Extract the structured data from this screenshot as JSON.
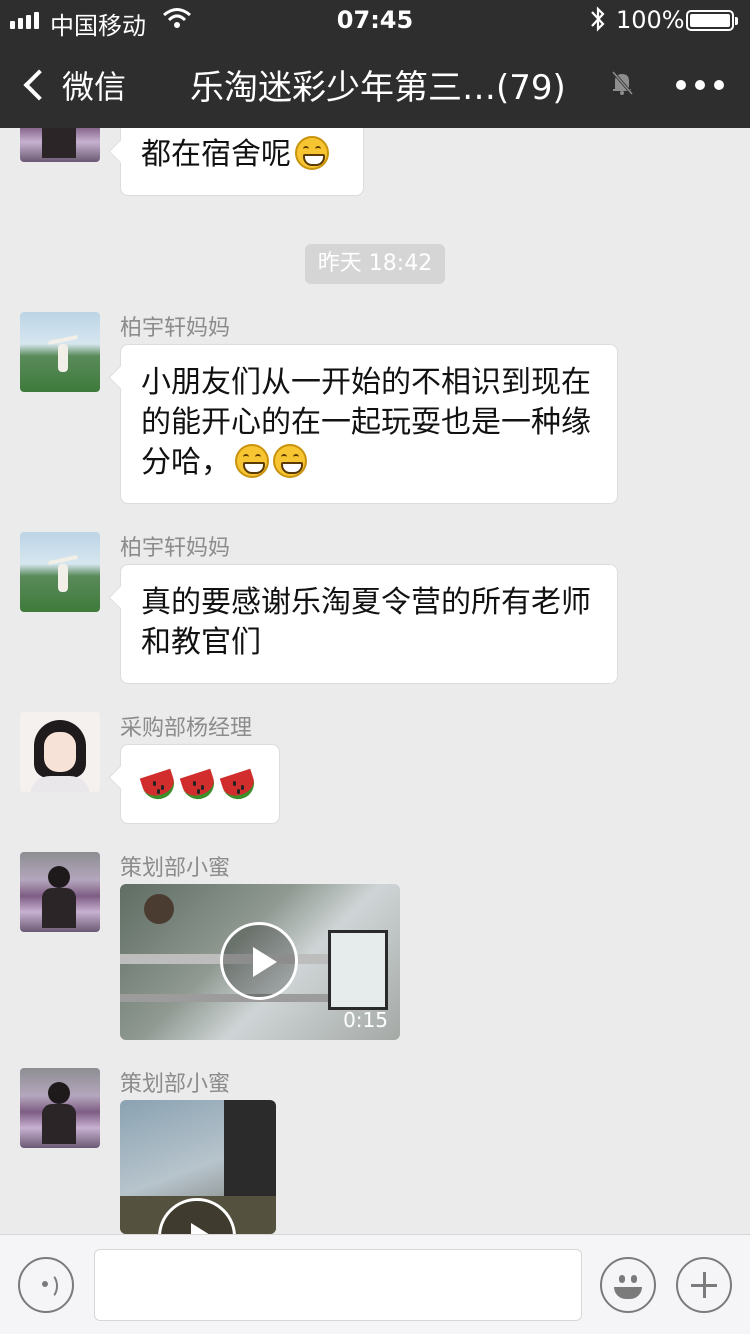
{
  "status_bar": {
    "carrier": "中国移动",
    "time": "07:45",
    "battery_percent": "100%",
    "wifi_icon": "wifi-icon",
    "bluetooth_icon": "bluetooth-icon"
  },
  "nav": {
    "back_label": "微信",
    "title": "乐淘迷彩少年第三…(79)",
    "mute_icon": "muted-bell-icon",
    "more_icon": "more-dots-icon"
  },
  "messages": [
    {
      "type": "text",
      "sender": "",
      "text": "都在宿舍呢",
      "emoji_count": 1
    },
    {
      "type": "timestamp",
      "text": "昨天 18:42"
    },
    {
      "type": "text",
      "sender": "柏宇轩妈妈",
      "text": "小朋友们从一开始的不相识到现在的能开心的在一起玩耍也是一种缘分哈，",
      "emoji_count": 2
    },
    {
      "type": "text",
      "sender": "柏宇轩妈妈",
      "text": "真的要感谢乐淘夏令营的所有老师和教官们"
    },
    {
      "type": "sticker",
      "sender": "采购部杨经理",
      "watermelon_count": 3
    },
    {
      "type": "video",
      "sender": "策划部小蜜",
      "duration": "0:15"
    },
    {
      "type": "video",
      "sender": "策划部小蜜",
      "duration": ""
    }
  ],
  "colors": {
    "nav_background": "#2e2e2e",
    "chat_background": "#ebebeb",
    "bubble_background": "#ffffff",
    "timestamp_background": "#d5d5d5"
  },
  "input_bar": {
    "voice_icon": "voice-icon",
    "emoji_icon": "emoji-icon",
    "plus_icon": "plus-icon",
    "value": ""
  }
}
